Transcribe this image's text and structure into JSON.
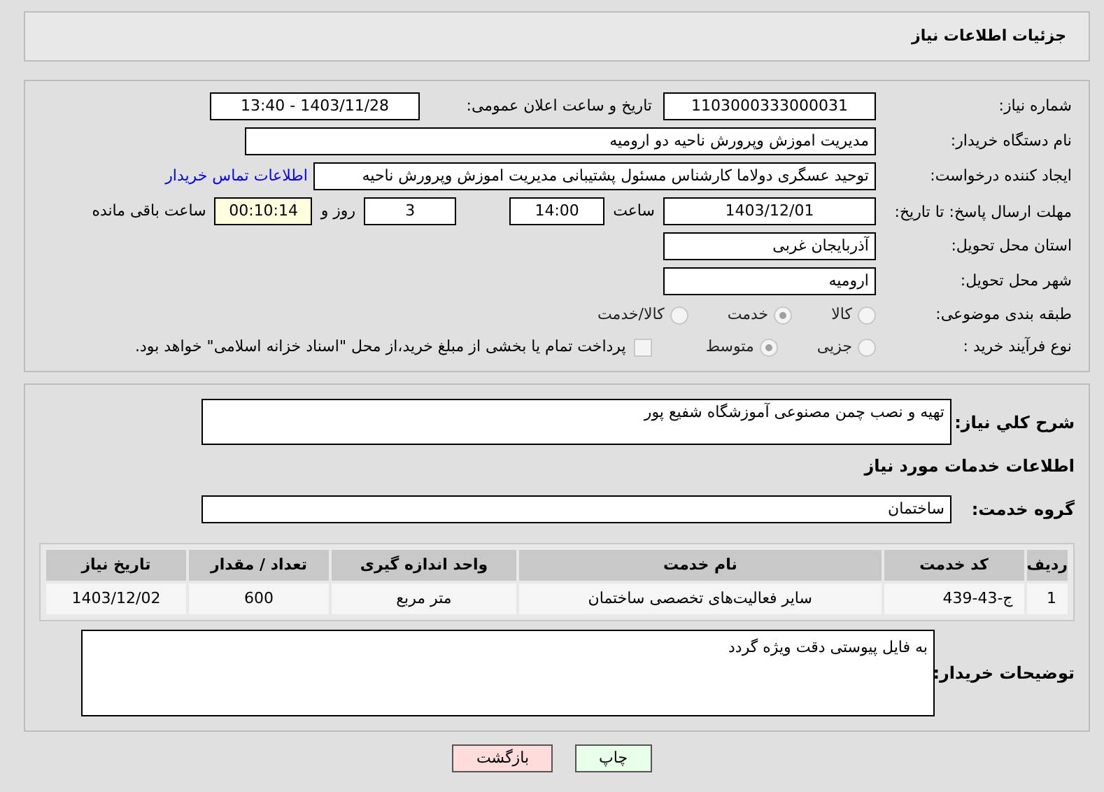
{
  "header": {
    "title": "جزئیات اطلاعات نیاز"
  },
  "details": {
    "need_number": {
      "label": "شماره نیاز:",
      "value": "1103000333000031"
    },
    "announce": {
      "label": "تاریخ و ساعت اعلان عمومی:",
      "value": "1403/11/28 - 13:40"
    },
    "buyer": {
      "label": "نام دستگاه خریدار:",
      "value": "مدیریت اموزش وپرورش ناحیه دو ارومیه"
    },
    "creator": {
      "label": "ایجاد کننده درخواست:",
      "value": "توحید عسگری دولاما کارشناس مسئول پشتیبانی مدیریت اموزش وپرورش ناحیه",
      "link": "اطلاعات تماس خریدار"
    },
    "deadline": {
      "label": "مهلت ارسال پاسخ: تا تاریخ:",
      "date": "1403/12/01",
      "time_label": "ساعت",
      "time": "14:00",
      "days": "3",
      "days_label": "روز و",
      "remaining": "00:10:14",
      "remaining_label": "ساعت باقی مانده"
    },
    "province": {
      "label": "استان محل تحویل:",
      "value": "آذربایجان غربی"
    },
    "city": {
      "label": "شهر محل تحویل:",
      "value": "ارومیه"
    },
    "category": {
      "label": "طبقه بندی موضوعی:",
      "options": [
        {
          "label": "کالا",
          "selected": false
        },
        {
          "label": "خدمت",
          "selected": true
        },
        {
          "label": "کالا/خدمت",
          "selected": false
        }
      ]
    },
    "process": {
      "label": "نوع فرآیند خرید :",
      "options": [
        {
          "label": "جزیی",
          "selected": false
        },
        {
          "label": "متوسط",
          "selected": true
        }
      ],
      "payment": {
        "label": "پرداخت تمام یا بخشی از مبلغ خرید،از محل \"اسناد خزانه اسلامی\" خواهد بود.",
        "checked": false
      }
    }
  },
  "need": {
    "summary_label": "شرح کلي نياز:",
    "summary": "تهیه و نصب چمن مصنوعی آموزشگاه شفیع پور",
    "services_heading": "اطلاعات خدمات مورد نیاز",
    "group_label": "گروه خدمت:",
    "group": "ساختمان",
    "table": {
      "columns": [
        "ردیف",
        "کد خدمت",
        "نام خدمت",
        "واحد اندازه گیری",
        "تعداد / مقدار",
        "تاریخ نیاز"
      ],
      "rows": [
        [
          "1",
          "ج-43-439",
          "سایر فعالیت‌های تخصصی ساختمان",
          "متر مربع",
          "600",
          "1403/12/02"
        ]
      ]
    },
    "notes_label": "توضیحات خریدار:",
    "notes": "به فایل پیوستی دقت ویژه گردد"
  },
  "buttons": [
    {
      "kind": "print",
      "label": "چاپ"
    },
    {
      "kind": "back",
      "label": "بازگشت"
    }
  ]
}
